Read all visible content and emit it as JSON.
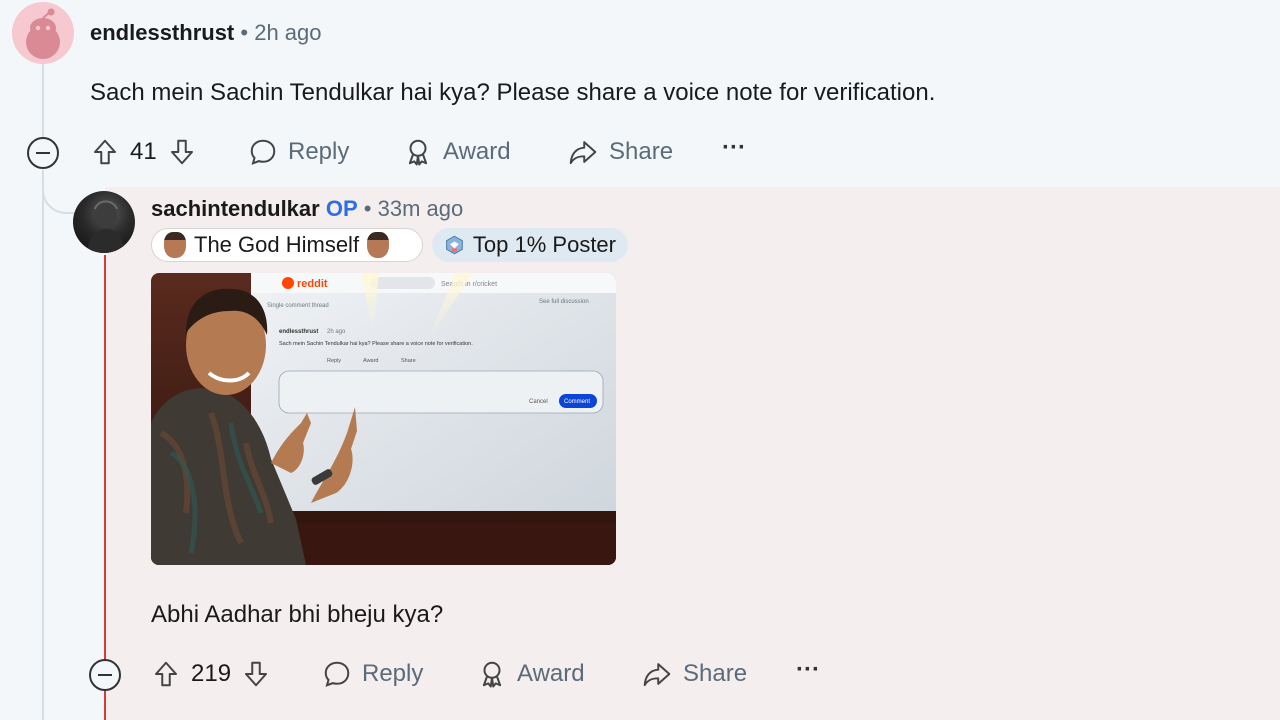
{
  "comment1": {
    "author": "endlessthrust",
    "separator": "•",
    "time": "2h ago",
    "body": "Sach mein Sachin Tendulkar hai kya? Please share a voice note for verification.",
    "votes": "41",
    "reply_label": "Reply",
    "award_label": "Award",
    "share_label": "Share",
    "more_label": "···"
  },
  "comment2": {
    "author": "sachintendulkar",
    "op_badge": "OP",
    "separator": "•",
    "time": "33m ago",
    "flair_user": "The God Himself",
    "flair_achievement": "Top 1% Poster",
    "body": "Abhi Aadhar bhi bheju kya?",
    "votes": "219",
    "reply_label": "Reply",
    "award_label": "Award",
    "share_label": "Share",
    "more_label": "···",
    "image": {
      "screen_logo": "reddit",
      "screen_search": "Search in r/cricket",
      "screen_single_thread": "Single comment thread",
      "screen_see_full": "See full discussion",
      "screen_comment_author": "endlessthrust",
      "screen_comment_time": "2h ago",
      "screen_comment_text": "Sach mein Sachin Tendulkar hai kya? Please share a voice note for verification.",
      "screen_reply": "Reply",
      "screen_award": "Award",
      "screen_share": "Share",
      "screen_cancel": "Cancel",
      "screen_comment_btn": "Comment"
    }
  },
  "colors": {
    "page_bg": "#f4f7fa",
    "reply_bg": "#f5eeee",
    "op_blue": "#2f6fe4",
    "thread_red": "#d73a3a",
    "muted": "#5b6b7a"
  }
}
